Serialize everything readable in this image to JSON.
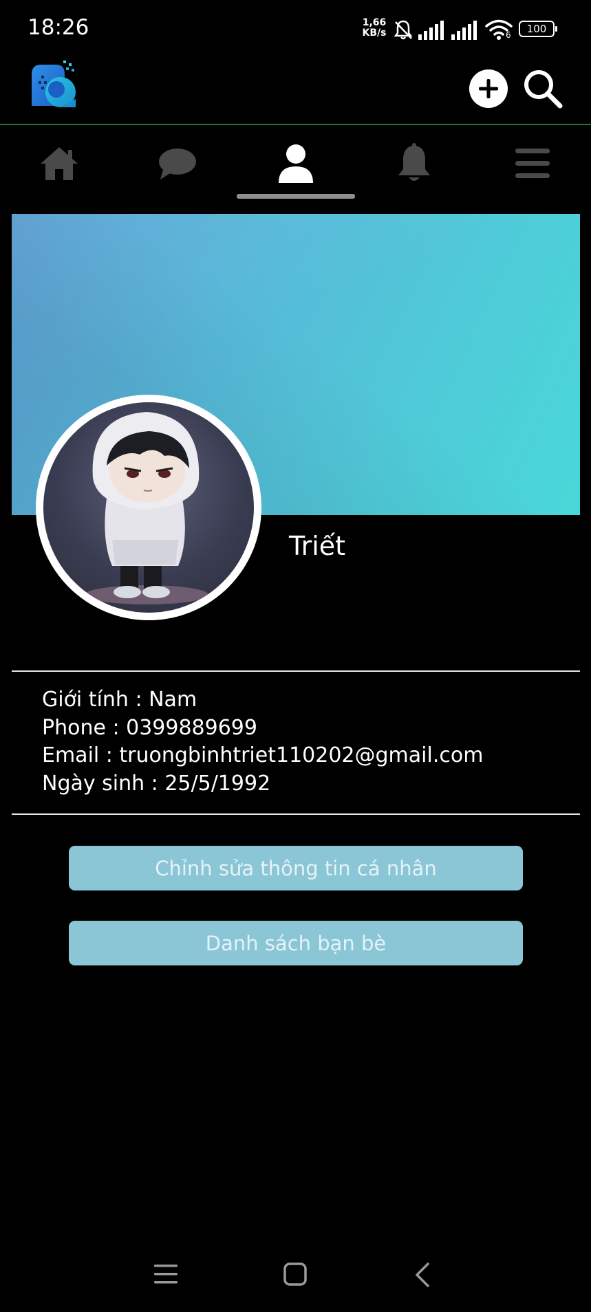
{
  "status_bar": {
    "time": "18:26",
    "speed_value": "1,66",
    "speed_unit": "KB/s",
    "battery": "100",
    "network_label": "6"
  },
  "top_bar": {
    "logo_icon": "app-logo-icon",
    "add_icon": "plus-icon",
    "search_icon": "search-icon",
    "divider_color": "#1f7a34"
  },
  "nav": {
    "tabs": [
      {
        "icon": "home-icon",
        "active": false
      },
      {
        "icon": "chat-icon",
        "active": false
      },
      {
        "icon": "user-icon",
        "active": true
      },
      {
        "icon": "bell-icon",
        "active": false
      },
      {
        "icon": "menu-icon",
        "active": false
      }
    ]
  },
  "profile": {
    "name": "Triết",
    "info": {
      "gender": "Giới tính : Nam",
      "phone": "Phone : 0399889699",
      "email": "Email : truongbinhtriet110202@gmail.com",
      "birthday": "Ngày sinh : 25/5/1992"
    }
  },
  "actions": {
    "edit_label": "Chỉnh sửa thông tin cá nhân",
    "friends_label": "Danh sách bạn bè",
    "button_color": "#8ac6d6"
  },
  "system_nav": {
    "icons": [
      "recents-icon",
      "home-square-icon",
      "back-icon"
    ]
  }
}
